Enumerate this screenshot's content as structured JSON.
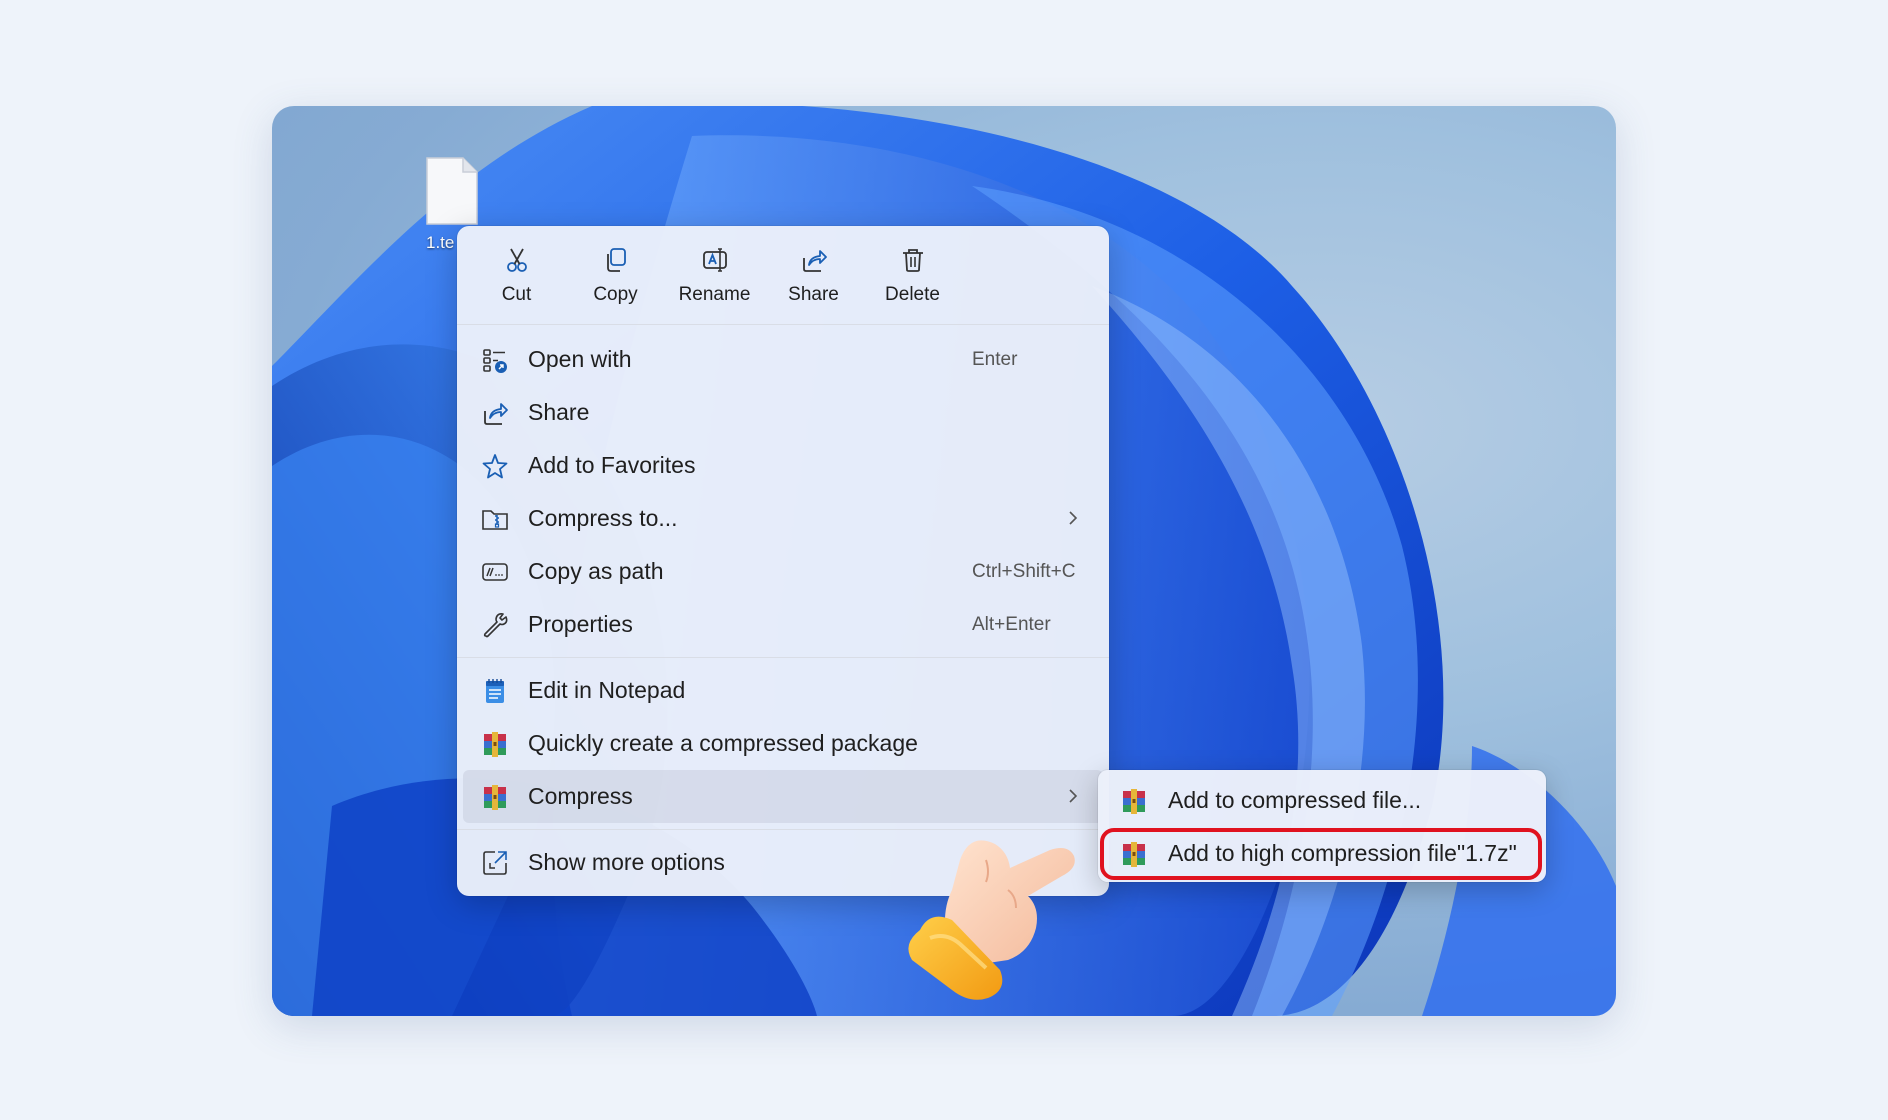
{
  "desktop": {
    "file_label": "1.te"
  },
  "toolbar": [
    {
      "label": "Cut",
      "icon": "scissors-icon"
    },
    {
      "label": "Copy",
      "icon": "copy-icon"
    },
    {
      "label": "Rename",
      "icon": "rename-icon"
    },
    {
      "label": "Share",
      "icon": "share-icon"
    },
    {
      "label": "Delete",
      "icon": "trash-icon"
    }
  ],
  "menu": {
    "open_with": {
      "label": "Open with",
      "shortcut": "Enter",
      "icon": "open-with-icon"
    },
    "share": {
      "label": "Share",
      "icon": "share-icon"
    },
    "favorites": {
      "label": "Add to Favorites",
      "icon": "star-icon"
    },
    "compress_to": {
      "label": "Compress to...",
      "icon": "archive-folder-icon"
    },
    "copy_path": {
      "label": "Copy as path",
      "shortcut": "Ctrl+Shift+C",
      "icon": "path-icon"
    },
    "properties": {
      "label": "Properties",
      "shortcut": "Alt+Enter",
      "icon": "wrench-icon"
    },
    "notepad": {
      "label": "Edit in Notepad",
      "icon": "notepad-icon"
    },
    "quick_compress": {
      "label": "Quickly create a compressed package",
      "icon": "winrar-icon"
    },
    "compress": {
      "label": "Compress",
      "icon": "winrar-icon"
    },
    "more_options": {
      "label": "Show more options",
      "icon": "expand-icon"
    }
  },
  "submenu": {
    "add_compressed": {
      "label": "Add to compressed file...",
      "icon": "winrar-icon"
    },
    "add_high": {
      "label": "Add to high compression file\"1.7z\"",
      "icon": "winrar-icon"
    }
  },
  "colors": {
    "highlight": "#e0121f",
    "accent": "#1a5fb4",
    "wallpaper_blue": "#1f5fe0"
  }
}
